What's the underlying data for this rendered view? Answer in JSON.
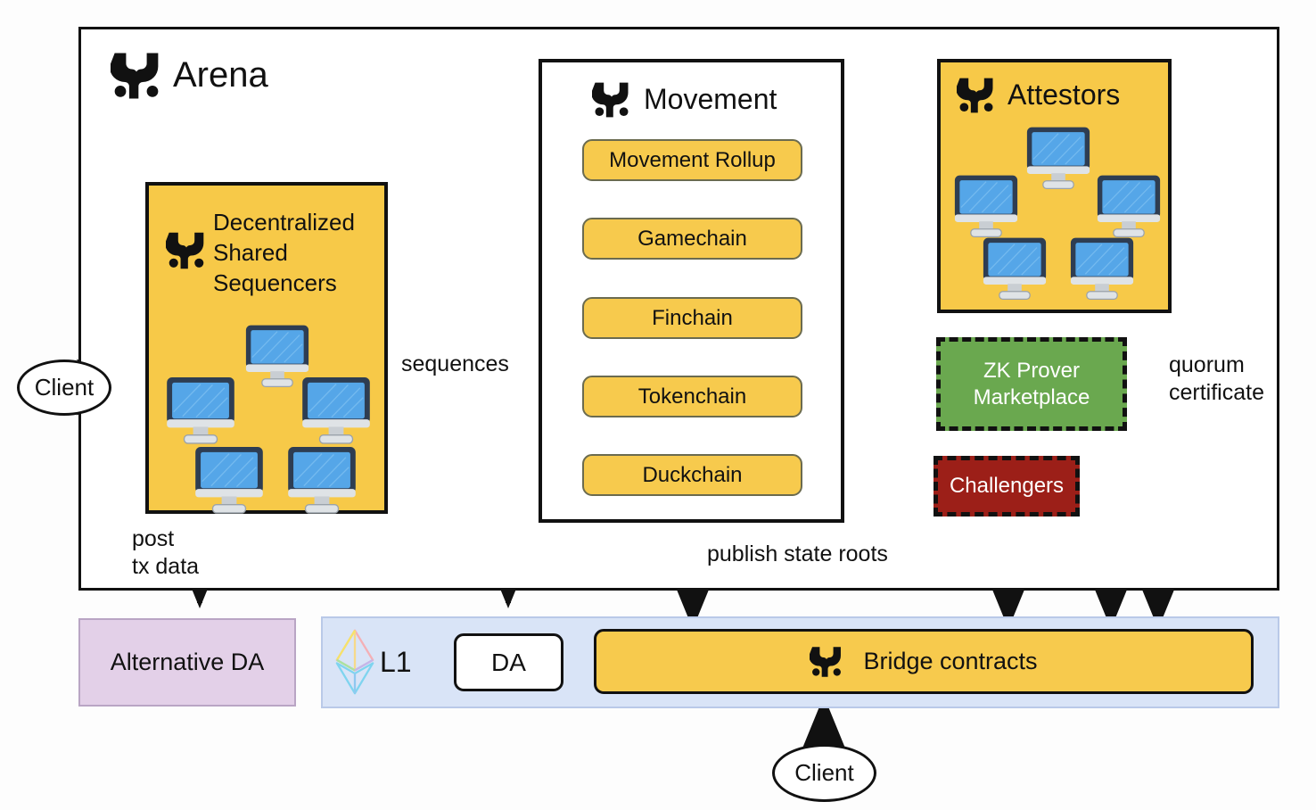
{
  "diagram": {
    "title": "Arena",
    "arena": {
      "label": "Arena",
      "logo_icon": "movement-logo-icon"
    },
    "sequencers": {
      "label": "Decentralized Shared Sequencers",
      "label_lines": [
        "Decentralized",
        "Shared",
        "Sequencers"
      ],
      "logo_icon": "movement-logo-icon",
      "node_count": 5,
      "node_icon": "monitor-icon",
      "fill": "#f7c948"
    },
    "movement": {
      "label": "Movement",
      "logo_icon": "movement-logo-icon",
      "chains": [
        {
          "label": "Movement Rollup"
        },
        {
          "label": "Gamechain"
        },
        {
          "label": "Finchain"
        },
        {
          "label": "Tokenchain"
        },
        {
          "label": "Duckchain"
        }
      ]
    },
    "attestors": {
      "label": "Attestors",
      "logo_icon": "movement-logo-icon",
      "node_count": 5,
      "node_icon": "monitor-icon",
      "fill": "#f7c948"
    },
    "zk_prover": {
      "label": "ZK Prover Marketplace",
      "label_lines": [
        "ZK Prover",
        "Marketplace"
      ],
      "fill": "#6aa84f",
      "border_style": "dashed"
    },
    "challengers": {
      "label": "Challengers",
      "fill": "#9c1f18",
      "border_style": "dashed"
    },
    "alternative_da": {
      "label": "Alternative DA",
      "fill": "#e3d0e8"
    },
    "l1": {
      "label": "L1",
      "logo_icon": "ethereum-logo-icon",
      "fill": "#d9e4f7",
      "da": {
        "label": "DA"
      },
      "bridge": {
        "label": "Bridge contracts",
        "logo_icon": "movement-logo-icon",
        "fill": "#f7ca4d"
      }
    },
    "clients": [
      {
        "label": "Client",
        "position": "left"
      },
      {
        "label": "Client",
        "position": "bottom"
      }
    ],
    "edges": [
      {
        "label": "sequences",
        "style": "solid"
      },
      {
        "label": "post tx data",
        "label_lines": [
          "post",
          "tx data"
        ],
        "style": "solid"
      },
      {
        "label": "publish state roots",
        "style": "solid"
      },
      {
        "label": "quorum certificate",
        "label_lines": [
          "quorum",
          "certificate"
        ],
        "style": "solid"
      }
    ],
    "colors": {
      "yellow": "#f7c948",
      "pill_yellow": "#f7ca4d",
      "green": "#6aa84f",
      "dark_red": "#9c1f18",
      "lavender": "#e3d0e8",
      "light_blue": "#d9e4f7",
      "stroke": "#111111"
    }
  }
}
